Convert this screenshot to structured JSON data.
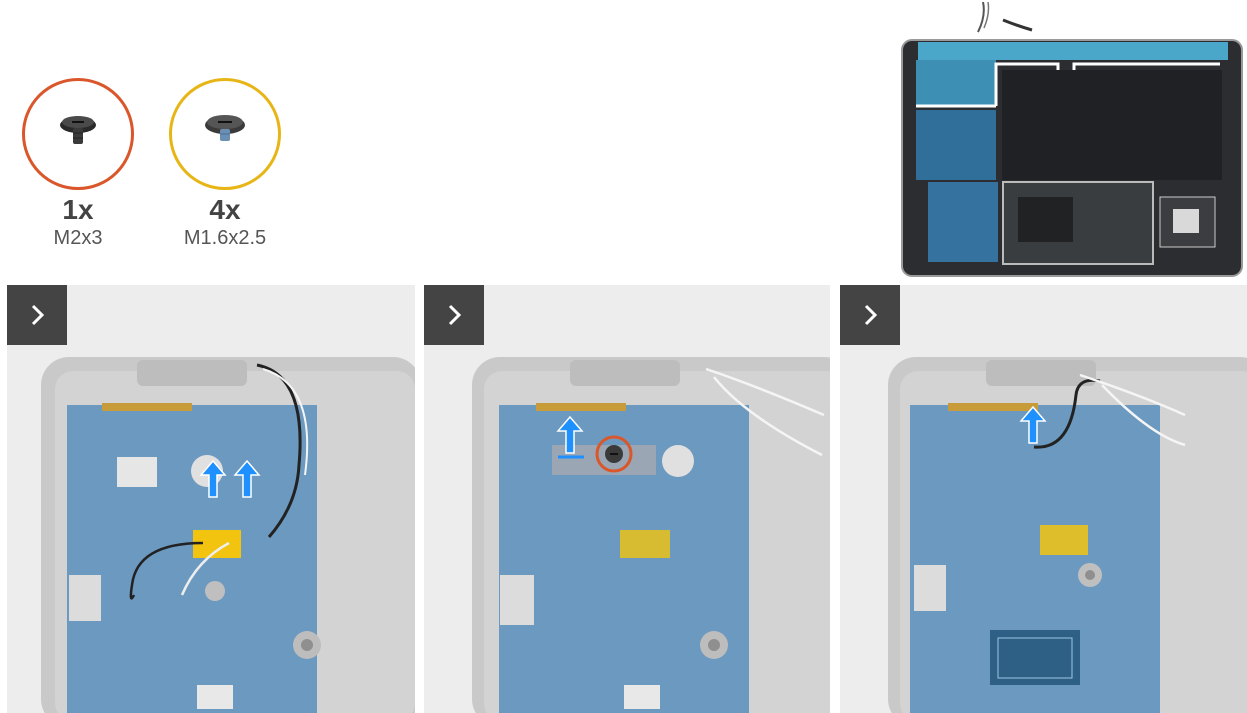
{
  "screws": [
    {
      "quantity": "1x",
      "size": "M2x3",
      "color": "#d9572b"
    },
    {
      "quantity": "4x",
      "size": "M1.6x2.5",
      "color": "#e8b517"
    }
  ],
  "steps": [
    {
      "icon": "chevron-right-icon"
    },
    {
      "icon": "chevron-right-icon"
    },
    {
      "icon": "chevron-right-icon"
    }
  ],
  "colors": {
    "board": "#4a86b8",
    "chassis": "#c9c9c9",
    "arrow": "#1e90ff",
    "tape": "#f2c40f",
    "button": "#444444"
  }
}
